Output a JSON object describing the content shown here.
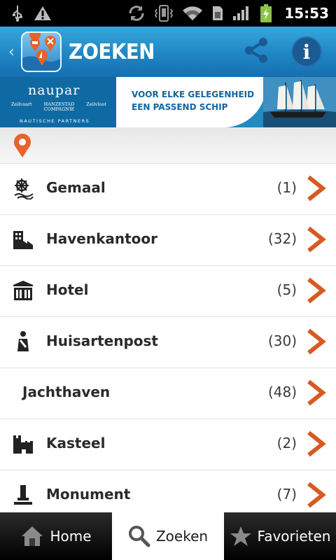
{
  "status_bar": {
    "time": "15:53",
    "icons": [
      "usb-icon",
      "warning-icon",
      "sync-icon",
      "vibrate-icon",
      "wifi-icon",
      "sim-icon",
      "signal-icon",
      "battery-charging-icon"
    ]
  },
  "action_bar": {
    "title": "ZOEKEN",
    "share_icon": "share-icon",
    "info_label": "i"
  },
  "banner": {
    "brand": "naupar",
    "sub_brands": [
      "Zeilvaart",
      "HANZESTAD COMPAGNIE",
      "Zeilvloot"
    ],
    "tagline": "NAUTISCHE PARTNERS",
    "line1": "VOOR ELKE GELEGENHEID",
    "line2": "EEN PASSEND SCHIP"
  },
  "list": {
    "items": [
      {
        "label": "Gemaal",
        "count": "(1)",
        "icon": "pumping-station-icon"
      },
      {
        "label": "Havenkantoor",
        "count": "(32)",
        "icon": "harbour-office-icon"
      },
      {
        "label": "Hotel",
        "count": "(5)",
        "icon": "hotel-icon"
      },
      {
        "label": "Huisartenpost",
        "count": "(30)",
        "icon": "doctor-icon"
      },
      {
        "label": "Jachthaven",
        "count": "(48)",
        "icon": ""
      },
      {
        "label": "Kasteel",
        "count": "(2)",
        "icon": "castle-icon"
      },
      {
        "label": "Monument",
        "count": "(7)",
        "icon": "monument-icon"
      }
    ]
  },
  "tab_bar": {
    "tabs": [
      {
        "label": "Home",
        "icon": "home-icon"
      },
      {
        "label": "Zoeken",
        "icon": "search-icon",
        "active": true
      },
      {
        "label": "Favorieten",
        "icon": "star-icon"
      }
    ]
  },
  "colors": {
    "action_bar": "#1f86c4",
    "chevron": "#d65a22",
    "pin": "#e8622a"
  }
}
